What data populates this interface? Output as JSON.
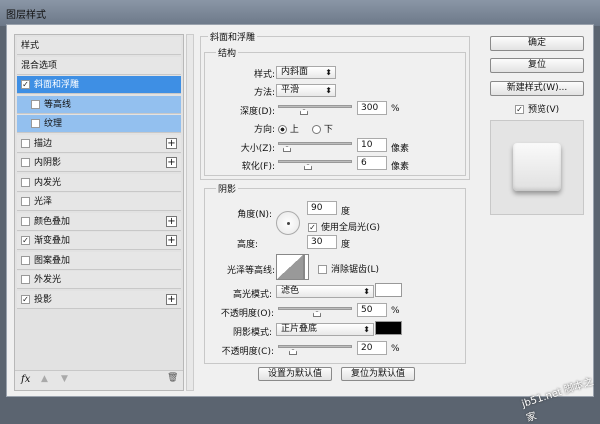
{
  "window": {
    "title": "图层样式"
  },
  "sidebar": {
    "items": [
      {
        "label": "样式",
        "checkbox": false,
        "plus": false
      },
      {
        "label": "混合选项",
        "checkbox": false,
        "plus": false
      },
      {
        "label": "斜面和浮雕",
        "checkbox": true,
        "checked": true,
        "selected": true,
        "plus": false
      },
      {
        "label": "等高线",
        "checkbox": true,
        "checked": false,
        "sub": true
      },
      {
        "label": "纹理",
        "checkbox": true,
        "checked": false,
        "sub": true
      },
      {
        "label": "描边",
        "checkbox": true,
        "checked": false,
        "plus": true
      },
      {
        "label": "内阴影",
        "checkbox": true,
        "checked": false,
        "plus": true
      },
      {
        "label": "内发光",
        "checkbox": true,
        "checked": false
      },
      {
        "label": "光泽",
        "checkbox": true,
        "checked": false
      },
      {
        "label": "颜色叠加",
        "checkbox": true,
        "checked": false,
        "plus": true
      },
      {
        "label": "渐变叠加",
        "checkbox": true,
        "checked": true,
        "plus": true
      },
      {
        "label": "图案叠加",
        "checkbox": true,
        "checked": false
      },
      {
        "label": "外发光",
        "checkbox": true,
        "checked": false
      },
      {
        "label": "投影",
        "checkbox": true,
        "checked": true,
        "plus": true
      }
    ],
    "fx": "fx"
  },
  "bevel": {
    "title": "斜面和浮雕",
    "structure": "结构",
    "style_label": "样式:",
    "style_value": "内斜面",
    "technique_label": "方法:",
    "technique_value": "平滑",
    "depth_label": "深度(D):",
    "depth_value": "300",
    "depth_unit": "%",
    "direction_label": "方向:",
    "dir_up": "上",
    "dir_down": "下",
    "direction": "上",
    "size_label": "大小(Z):",
    "size_value": "10",
    "size_unit": "像素",
    "soften_label": "软化(F):",
    "soften_value": "6",
    "soften_unit": "像素"
  },
  "shading": {
    "title": "阴影",
    "angle_label": "角度(N):",
    "angle_value": "90",
    "angle_unit": "度",
    "global_light": "使用全局光(G)",
    "global_light_checked": true,
    "altitude_label": "高度:",
    "altitude_value": "30",
    "altitude_unit": "度",
    "gloss_label": "光泽等高线:",
    "antialias": "消除锯齿(L)",
    "antialias_checked": false,
    "highlight_label": "高光模式:",
    "highlight_mode": "滤色",
    "highlight_color": "#ffffff",
    "hl_opacity_label": "不透明度(O):",
    "hl_opacity": "50",
    "hl_unit": "%",
    "shadow_label": "阴影模式:",
    "shadow_mode": "正片叠底",
    "shadow_color": "#000000",
    "sh_opacity_label": "不透明度(C):",
    "sh_opacity": "20",
    "sh_unit": "%"
  },
  "buttons": {
    "make_default": "设置为默认值",
    "reset_default": "复位为默认值",
    "ok": "确定",
    "reset": "复位",
    "new_style": "新建样式(W)...",
    "preview": "预览(V)",
    "preview_checked": true
  },
  "watermark": "jb51.net 脚本之家",
  "colors": {
    "selected": "#3e8fe4",
    "sub_selected": "#93c0ef"
  }
}
